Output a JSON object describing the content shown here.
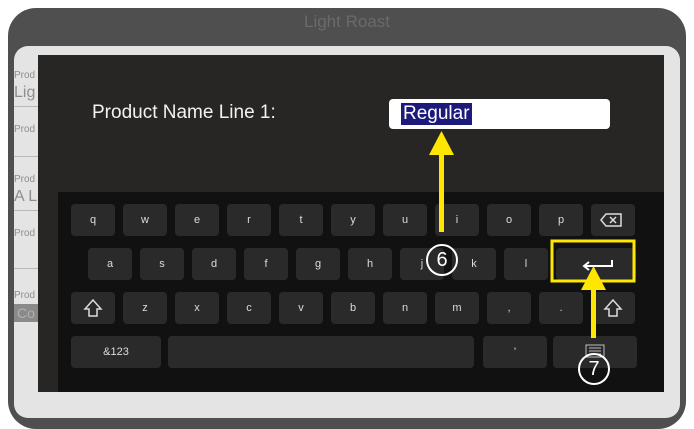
{
  "background": {
    "title": "Light Roast",
    "labels": [
      "Prod",
      "Prod",
      "Prod",
      "Prod",
      "Prod"
    ],
    "values": [
      "Lig",
      "A L"
    ],
    "dark_value": "Co"
  },
  "dialog": {
    "prompt": "Product Name Line 1:",
    "field_value": "Regular"
  },
  "keyboard": {
    "row1": [
      "q",
      "w",
      "e",
      "r",
      "t",
      "y",
      "u",
      "i",
      "o",
      "p"
    ],
    "row2": [
      "a",
      "s",
      "d",
      "f",
      "g",
      "h",
      "j",
      "k",
      "l"
    ],
    "row3": [
      "z",
      "x",
      "c",
      "v",
      "b",
      "n",
      "m",
      ",",
      "."
    ],
    "symbols_label": "&123",
    "apostrophe": "'"
  },
  "annotations": {
    "badge_6": "6",
    "badge_7": "7",
    "color": "#ffe600"
  }
}
